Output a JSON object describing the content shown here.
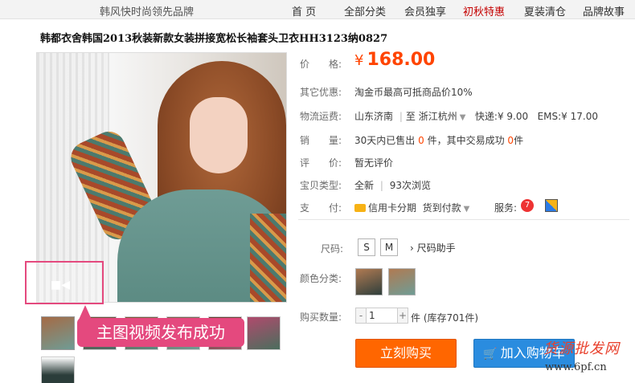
{
  "nav": {
    "brand": "韩风快时尚领先品牌",
    "items": [
      "首 页",
      "全部分类",
      "会员独享",
      "初秋特惠",
      "夏装清仓",
      "品牌故事"
    ]
  },
  "product": {
    "title": "韩都衣舍韩国2013秋装新款女装拼接宽松长袖套头卫衣HH3123纳0827",
    "currency": "¥",
    "price": "168.00"
  },
  "labels": {
    "price": "价　　格:",
    "promo": "其它优惠:",
    "shipping": "物流运费:",
    "sales": "销　　量:",
    "rating": "评　　价:",
    "type": "宝贝类型:",
    "payment": "支　　付:",
    "size": "尺码:",
    "color": "颜色分类:",
    "qty": "购买数量:"
  },
  "values": {
    "promo": "淘金币最高可抵商品价10%",
    "ship_from": "山东济南",
    "ship_to_prefix": "至",
    "ship_to": "浙江杭州",
    "express": "快递:¥ 9.00",
    "ems": "EMS:¥ 17.00",
    "sales_pre": "30天内已售出",
    "sales_count": "0",
    "sales_mid": "件，其中交易成功",
    "sales_success": "0",
    "sales_unit": "件",
    "rating": "暂无评价",
    "condition": "全新",
    "views": "93次浏览",
    "pay_credit": "信用卡分期",
    "pay_cod": "货到付款",
    "service": "服务:"
  },
  "sizes": [
    "S",
    "M"
  ],
  "size_help": "尺码助手",
  "quantity": "1",
  "stock": "件 (库存701件)",
  "buttons": {
    "buy": "立刻购买",
    "cart": "加入购物车"
  },
  "overlay": {
    "bubble": "主图视频发布成功"
  },
  "watermark": {
    "line1": "货源批发网",
    "line2": "www.6pf.cn"
  },
  "colors": {
    "price": "#ff4400",
    "buy_button": "#ff6600",
    "cart_button": "#2a8cdf",
    "bubble": "#e4497e",
    "nav_highlight": "#c40000"
  }
}
